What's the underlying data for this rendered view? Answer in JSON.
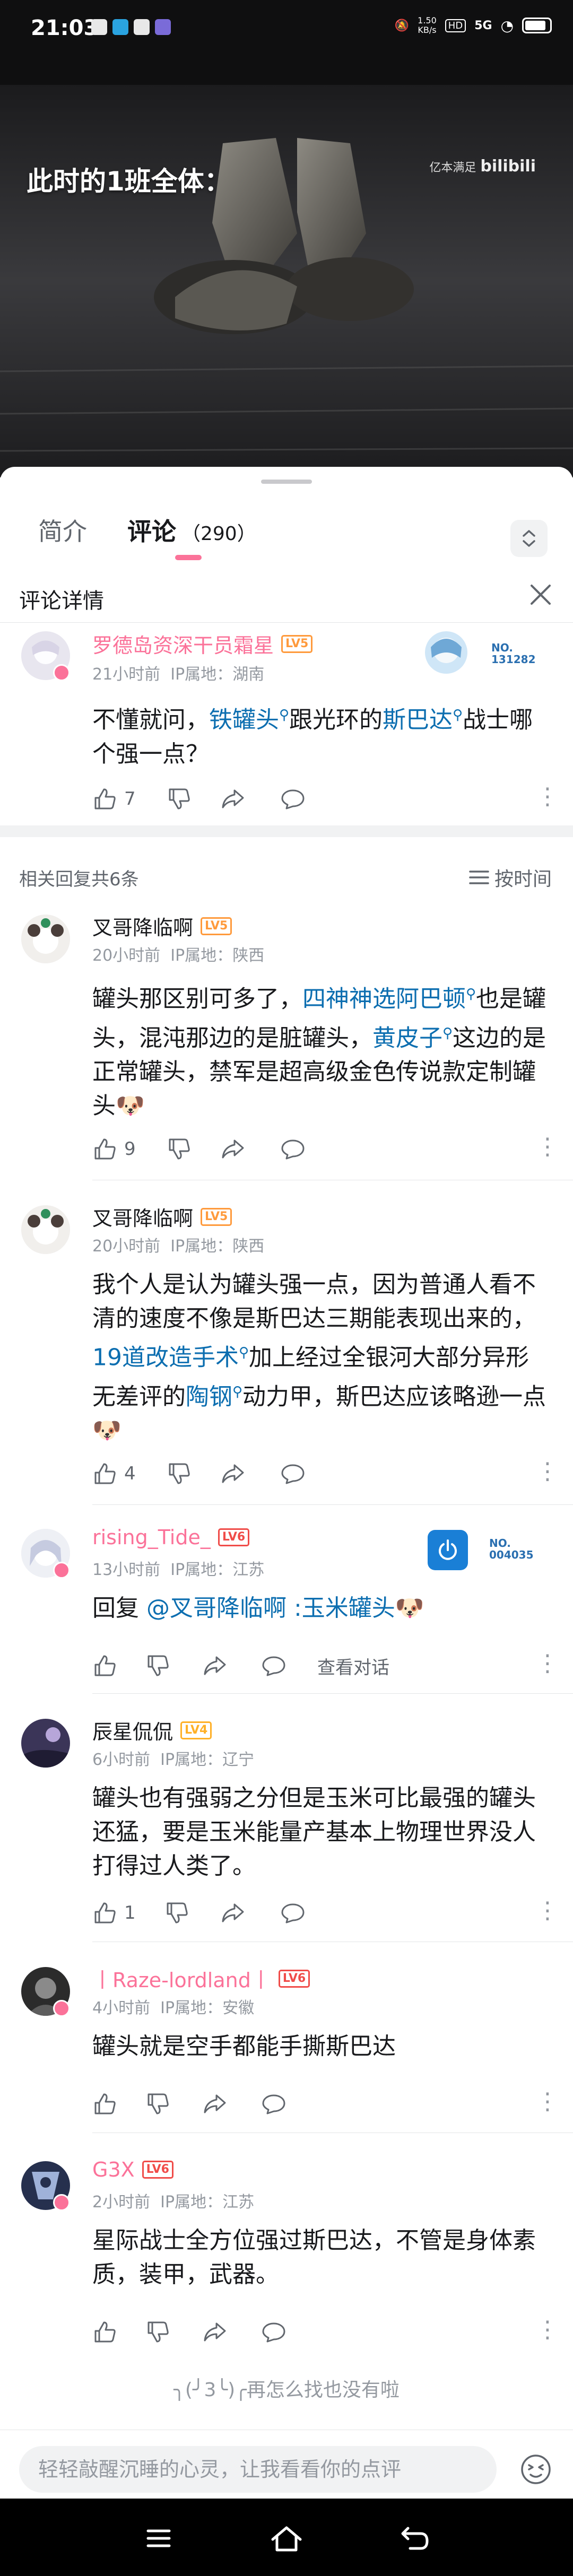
{
  "status_bar": {
    "time": "21:03",
    "net_speed": "1.50",
    "net_unit": "KB/s",
    "hd": "HD",
    "signal": "5G"
  },
  "video": {
    "caption": "此时的1班全体：",
    "watermark": "亿本满足",
    "logo": "bilibili"
  },
  "tabs": {
    "intro": "简介",
    "comments": "评论",
    "comment_count": "（290）"
  },
  "detail": {
    "title": "评论详情"
  },
  "main_comment": {
    "username": "罗德岛资深干员霜星",
    "level": "LV5",
    "time": "21小时前",
    "ip": "IP属地：湖南",
    "nameplate_no": "NO.",
    "nameplate_num": "131282",
    "text_1": "不懂就问，",
    "link_1": "铁罐头",
    "text_2": "跟光环的",
    "link_2": "斯巴达",
    "text_3": "战士哪个强一点？",
    "likes": "7"
  },
  "replies": {
    "title": "相关回复共6条",
    "sort_label": "按时间"
  },
  "reply_1": {
    "username": "叉哥降临啊",
    "level": "LV5",
    "time": "20小时前",
    "ip": "IP属地：陕西",
    "text_1": "罐头那区别可多了，",
    "link_1": "四神神选阿巴顿",
    "text_2": "也是罐头，混沌那边的是脏罐头，",
    "link_2": "黄皮子",
    "text_3": "这边的是正常罐头，禁军是超高级金色传说款定制罐头",
    "likes": "9"
  },
  "reply_2": {
    "username": "叉哥降临啊",
    "level": "LV5",
    "time": "20小时前",
    "ip": "IP属地：陕西",
    "text_1": "我个人是认为罐头强一点，因为普通人看不清的速度不像是斯巴达三期能表现出来的，",
    "link_1": "19道改造手术",
    "text_2": "加上经过全银河大部分异形无差评的",
    "link_2": "陶钢",
    "text_3": "动力甲，斯巴达应该略逊一点",
    "likes": "4"
  },
  "reply_3": {
    "username": "rising_Tide_",
    "level": "LV6",
    "time": "13小时前",
    "ip": "IP属地：江苏",
    "nameplate_no": "NO.",
    "nameplate_num": "004035",
    "text_1": "回复 ",
    "mention": "@叉哥降临啊",
    "text_2": " :玉米罐头",
    "view_chat": "查看对话"
  },
  "reply_4": {
    "username": "辰星侃侃",
    "level": "LV4",
    "time": "6小时前",
    "ip": "IP属地：辽宁",
    "text_1": "罐头也有强弱之分但是玉米可比最强的罐头还猛，要是玉米能量产基本上物理世界没人打得过人类了。",
    "likes": "1"
  },
  "reply_5": {
    "username": "丨Raze-lordland丨",
    "level": "LV6",
    "time": "4小时前",
    "ip": "IP属地：安徽",
    "text_1": "罐头就是空手都能手撕斯巴达"
  },
  "reply_6": {
    "username": "G3X",
    "level": "LV6",
    "time": "2小时前",
    "ip": "IP属地：江苏",
    "text_1": "星际战士全方位强过斯巴达，不管是身体素质，装甲，武器。"
  },
  "footer": {
    "end_note": "╮(╯3╰)╭再怎么找也没有啦"
  },
  "input": {
    "placeholder": "轻轻敲醒沉睡的心灵，让我看看你的点评"
  },
  "colors": {
    "accent_pink": "#fb7299",
    "link_blue": "#0c6eb0",
    "lv5_orange": "#ff9a3c",
    "lv6_red": "#f04c49",
    "lv4_yellow": "#ffb027"
  }
}
